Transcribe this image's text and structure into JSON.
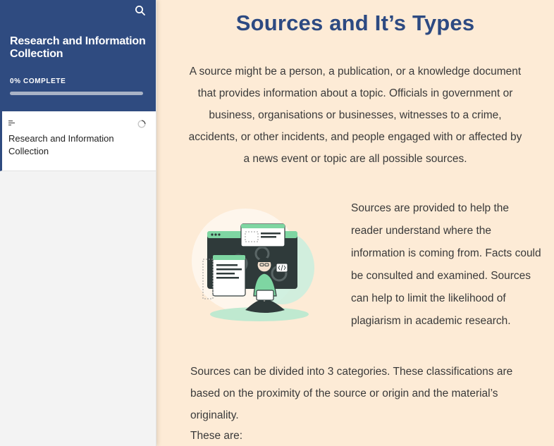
{
  "sidebar": {
    "course_title": "Research and Information Collection",
    "progress_label": "0% COMPLETE",
    "progress_fraction": 0,
    "lessons": [
      {
        "label": "Research and Information Collection"
      }
    ]
  },
  "main": {
    "title": "Sources and It’s Types",
    "intro": "A source might be a person, a publication, or a knowledge document that provides information about a topic. Officials in government or business, organisations or businesses, witnesses to a crime, accidents, or other incidents, and people engaged with or affected by a news event or topic are all possible sources.",
    "side_paragraph": "Sources are provided to help the reader understand where the information is coming from. Facts could be consulted and examined. Sources can help to limit the likelihood of plagiarism in academic research.",
    "categories_paragraph": "Sources can be divided into 3 categories. These classifications are based on the proximity of the source or origin and the material’s originality.",
    "these_are": "These are:"
  },
  "colors": {
    "sidebar_header": "#2f4b80",
    "title": "#2d4a82",
    "content_bg": "#fdebd6",
    "illustration_accent": "#7ed6a2"
  }
}
